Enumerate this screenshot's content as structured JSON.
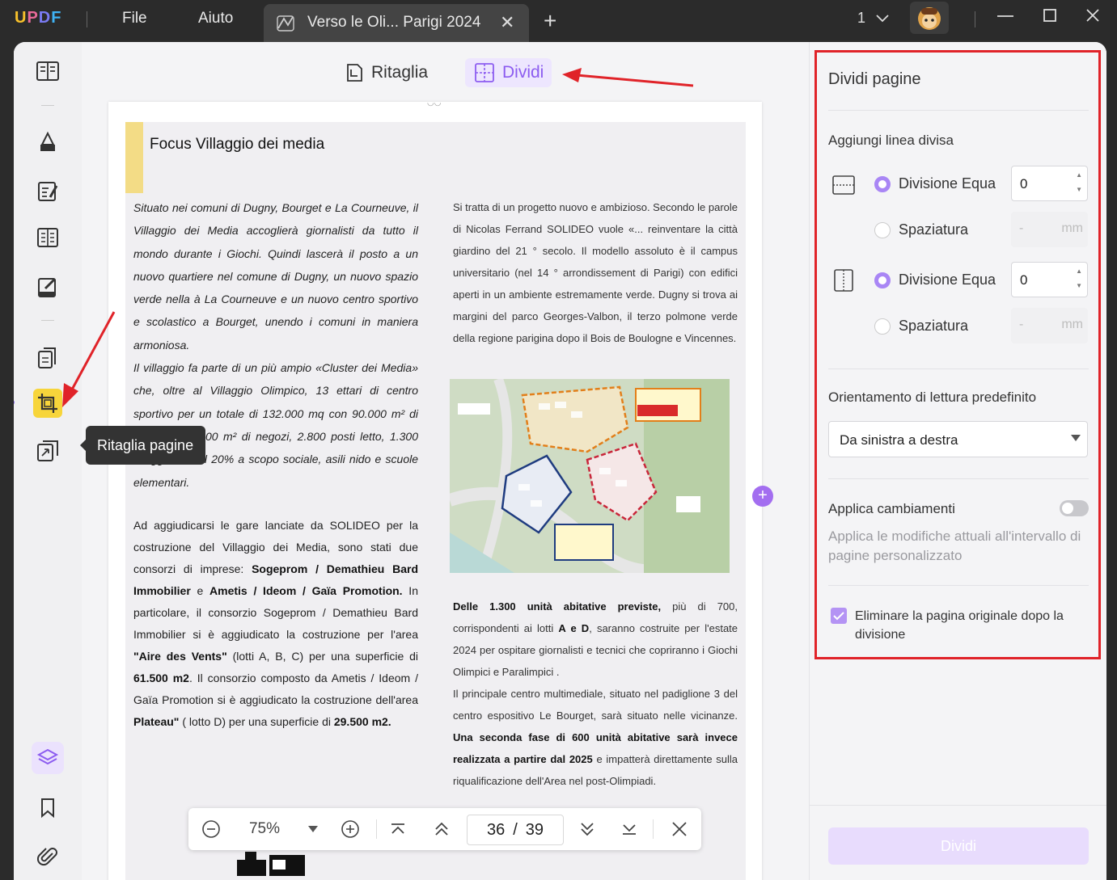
{
  "app": {
    "logo": "UPDF",
    "window_controls": [
      "minimize",
      "maximize",
      "close"
    ]
  },
  "menu": {
    "file": "File",
    "help": "Aiuto"
  },
  "tab": {
    "title": "Verso le Oli... Parigi 2024",
    "close": "✕",
    "new_tab": "+"
  },
  "page_indicator": "1",
  "modes": {
    "crop": "Ritaglia",
    "split": "Dividi"
  },
  "tooltip": "Ritaglia pagine",
  "document": {
    "title": "Focus Villaggio dei media",
    "left_italic": "Situato nei comuni di Dugny, Bourget e La Courneuve, il Villaggio dei Media accoglierà giornalisti da tutto il mondo durante i Giochi. Quindi lascerà il posto a un nuovo quartiere nel comune di Dugny, un nuovo spazio verde nella à La Courneuve e un nuovo centro sportivo e scolastico a Bourget, unendo i comuni in maniera armoniosa.",
    "left_italic2": "Il villaggio fa parte di un più ampio «Cluster dei Media» che, oltre al Villaggio Olimpico, 13 ettari di centro sportivo per un totale di 132.000 mq con 90.000 m² di abitazioni, 1.000 m² di negozi, 2.800 posti letto, 1.300 alloggi di cui il 20% a scopo sociale, asili nido e scuole elementari.",
    "left_p2_a": "Ad aggiudicarsi le gare lanciate da SOLIDEO per la costruzione del Villaggio dei Media, sono stati due consorzi di imprese: ",
    "left_p2_b": "Sogeprom / Demathieu Bard Immobilier",
    "left_p2_c": " e ",
    "left_p2_d": "Ametis / Ideom / Gaïa Promotion.",
    "left_p2_e": " In particolare, il consorzio Sogeprom / Demathieu Bard Immobilier si è aggiudicato la costruzione per l'area ",
    "left_p2_f": "\"Aire des Vents\"",
    "left_p2_g": " (lotti A, B, C) per una superficie di ",
    "left_p2_h": "61.500 m2",
    "left_p2_i": ". Il consorzio composto da Ametis / Ideom / Gaïa Promotion si è aggiudicato la costruzione dell'area ",
    "left_p2_j": "Plateau\"",
    "left_p2_k": " ( lotto D) per una superficie di ",
    "left_p2_l": "29.500 m2.",
    "right_p1": "Si tratta di un progetto nuovo e ambizioso. Secondo le parole di Nicolas Ferrand SOLIDEO vuole «... reinventare la città giardino del 21 ° secolo. Il modello assoluto è il campus universitario (nel 14 ° arrondissement di Parigi) con edifici aperti in un ambiente estremamente verde. Dugny si trova ai margini del parco Georges-Valbon, il terzo polmone verde della regione parigina dopo il Bois de Boulogne e Vincennes.",
    "right_p2_a": "Delle 1.300 unità abitative previste,",
    "right_p2_b": " più di 700, corrispondenti ai lotti ",
    "right_p2_c": "A e D",
    "right_p2_d": ", saranno costruite per l'estate 2024 per ospitare giornalisti e tecnici che copriranno i Giochi Olimpici e Paralimpici .",
    "right_p3_a": "Il principale centro multimediale, situato nel padiglione 3 del centro espositivo Le Bourget, sarà situato nelle vicinanze. ",
    "right_p3_b": "Una seconda fase di 600 unità abitative sarà invece realizzata a partire dal 2025",
    "right_p3_c": " e impatterà direttamente sulla riqualificazione dell'Area nel post-Olimpiadi."
  },
  "navbar": {
    "zoom": "75%",
    "current_page": "36",
    "separator": "/",
    "total_pages": "39"
  },
  "panel": {
    "title": "Dividi pagine",
    "add_line": "Aggiungi linea divisa",
    "h_equal": "Divisione Equa",
    "h_equal_value": "0",
    "h_spacing": "Spaziatura",
    "v_equal": "Divisione Equa",
    "v_equal_value": "0",
    "v_spacing": "Spaziatura",
    "spacing_placeholder": "-",
    "unit": "mm",
    "orientation_label": "Orientamento di lettura predefinito",
    "orientation_value": "Da sinistra a destra",
    "apply_label": "Applica cambiamenti",
    "apply_desc": "Applica le modifiche attuali all'intervallo di pagine personalizzato",
    "delete_original": "Eliminare la pagina originale dopo la divisione",
    "split_button": "Dividi"
  },
  "colors": {
    "accent": "#a986f5",
    "annotation": "#e02329",
    "tool_active": "#f7d53b"
  }
}
